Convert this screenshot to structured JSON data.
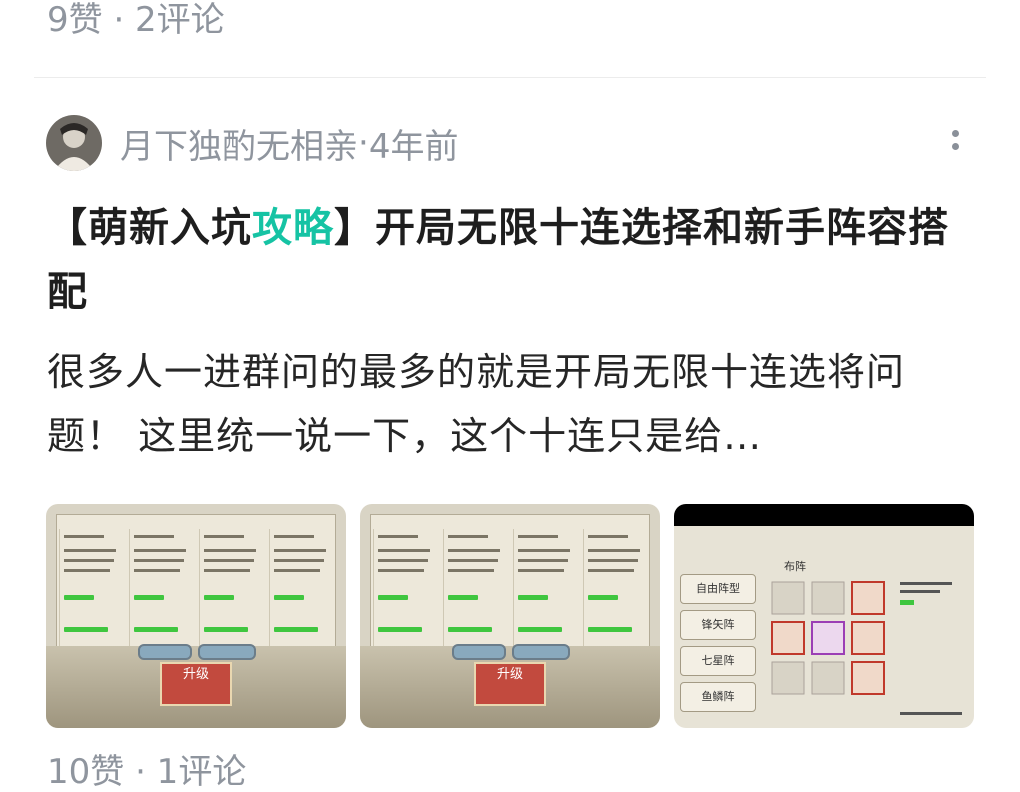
{
  "top_stats": "9赞 · 2评论",
  "post": {
    "author": "月下独酌无相亲",
    "time": "4年前",
    "separator": " · ",
    "title_prefix": "【萌新入坑",
    "title_highlight": "攻略",
    "title_suffix": "】开局无限十连选择和新手阵容搭配",
    "excerpt": "很多人一进群问的最多的就是开局无限十连选将问题！ 这里统一说一下，这个十连只是给…",
    "images": [
      {
        "name": "upgrade-screen-1",
        "button": "升级"
      },
      {
        "name": "upgrade-screen-2",
        "button": "升级"
      },
      {
        "name": "formation-screen",
        "menu": [
          "自由阵型",
          "锋矢阵",
          "七星阵",
          "鱼鳞阵"
        ],
        "heading": "布阵"
      }
    ]
  },
  "bottom_stats": "10赞 · 1评论",
  "colors": {
    "accent": "#16c3a4",
    "meta": "#8f959e"
  }
}
